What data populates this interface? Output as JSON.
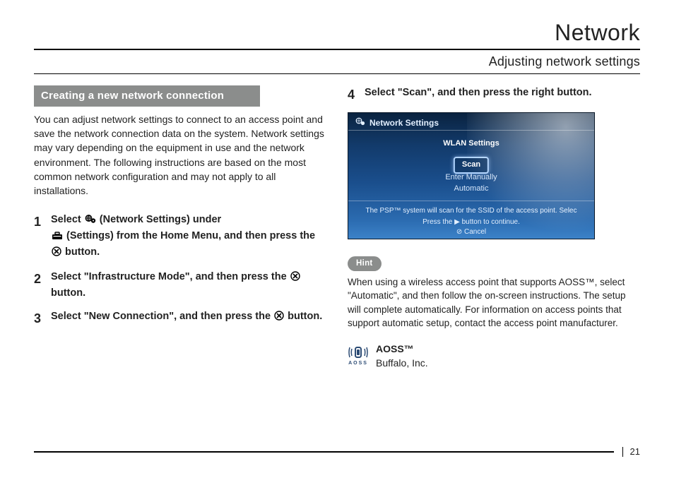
{
  "header": {
    "title": "Network",
    "subtitle": "Adjusting network settings"
  },
  "leftCol": {
    "sectionBar": "Creating a new network connection",
    "intro": "You can adjust network settings to connect to an access point and save the network connection data on the system. Network settings may vary depending on the equipment in use and the network environment. The following instructions are based on the most common network configuration and may not apply to all installations.",
    "steps": {
      "s1_a": "Select ",
      "s1_b": " (Network Settings) under",
      "s1_c": " (Settings) from the Home Menu, and then press the ",
      "s1_d": " button.",
      "s2_a": "Select \"Infrastructure Mode\", and then press the ",
      "s2_b": " button.",
      "s3_a": "Select \"New Connection\", and then press the ",
      "s3_b": " button."
    }
  },
  "rightCol": {
    "step4": "Select \"Scan\", and then press the right button.",
    "screenshot": {
      "top": "Network Settings",
      "wlan": "WLAN Settings",
      "scan": "Scan",
      "enter": "Enter Manually",
      "auto": "Automatic",
      "msg": "The PSP™ system will scan for the SSID of the access point. Selec",
      "press": "Press the ▶ button to continue.",
      "cancel": "⊘ Cancel"
    },
    "hintLabel": "Hint",
    "hintText": "When using a wireless access point that supports AOSS™, select \"Automatic\", and then follow the on-screen instructions. The setup will complete automatically. For information on access points that support automatic setup, contact the access point manufacturer.",
    "aoss": {
      "title": "AOSS™",
      "vendor": "Buffalo, Inc.",
      "iconLabel": "AOSS"
    }
  },
  "footer": {
    "page": "21"
  }
}
